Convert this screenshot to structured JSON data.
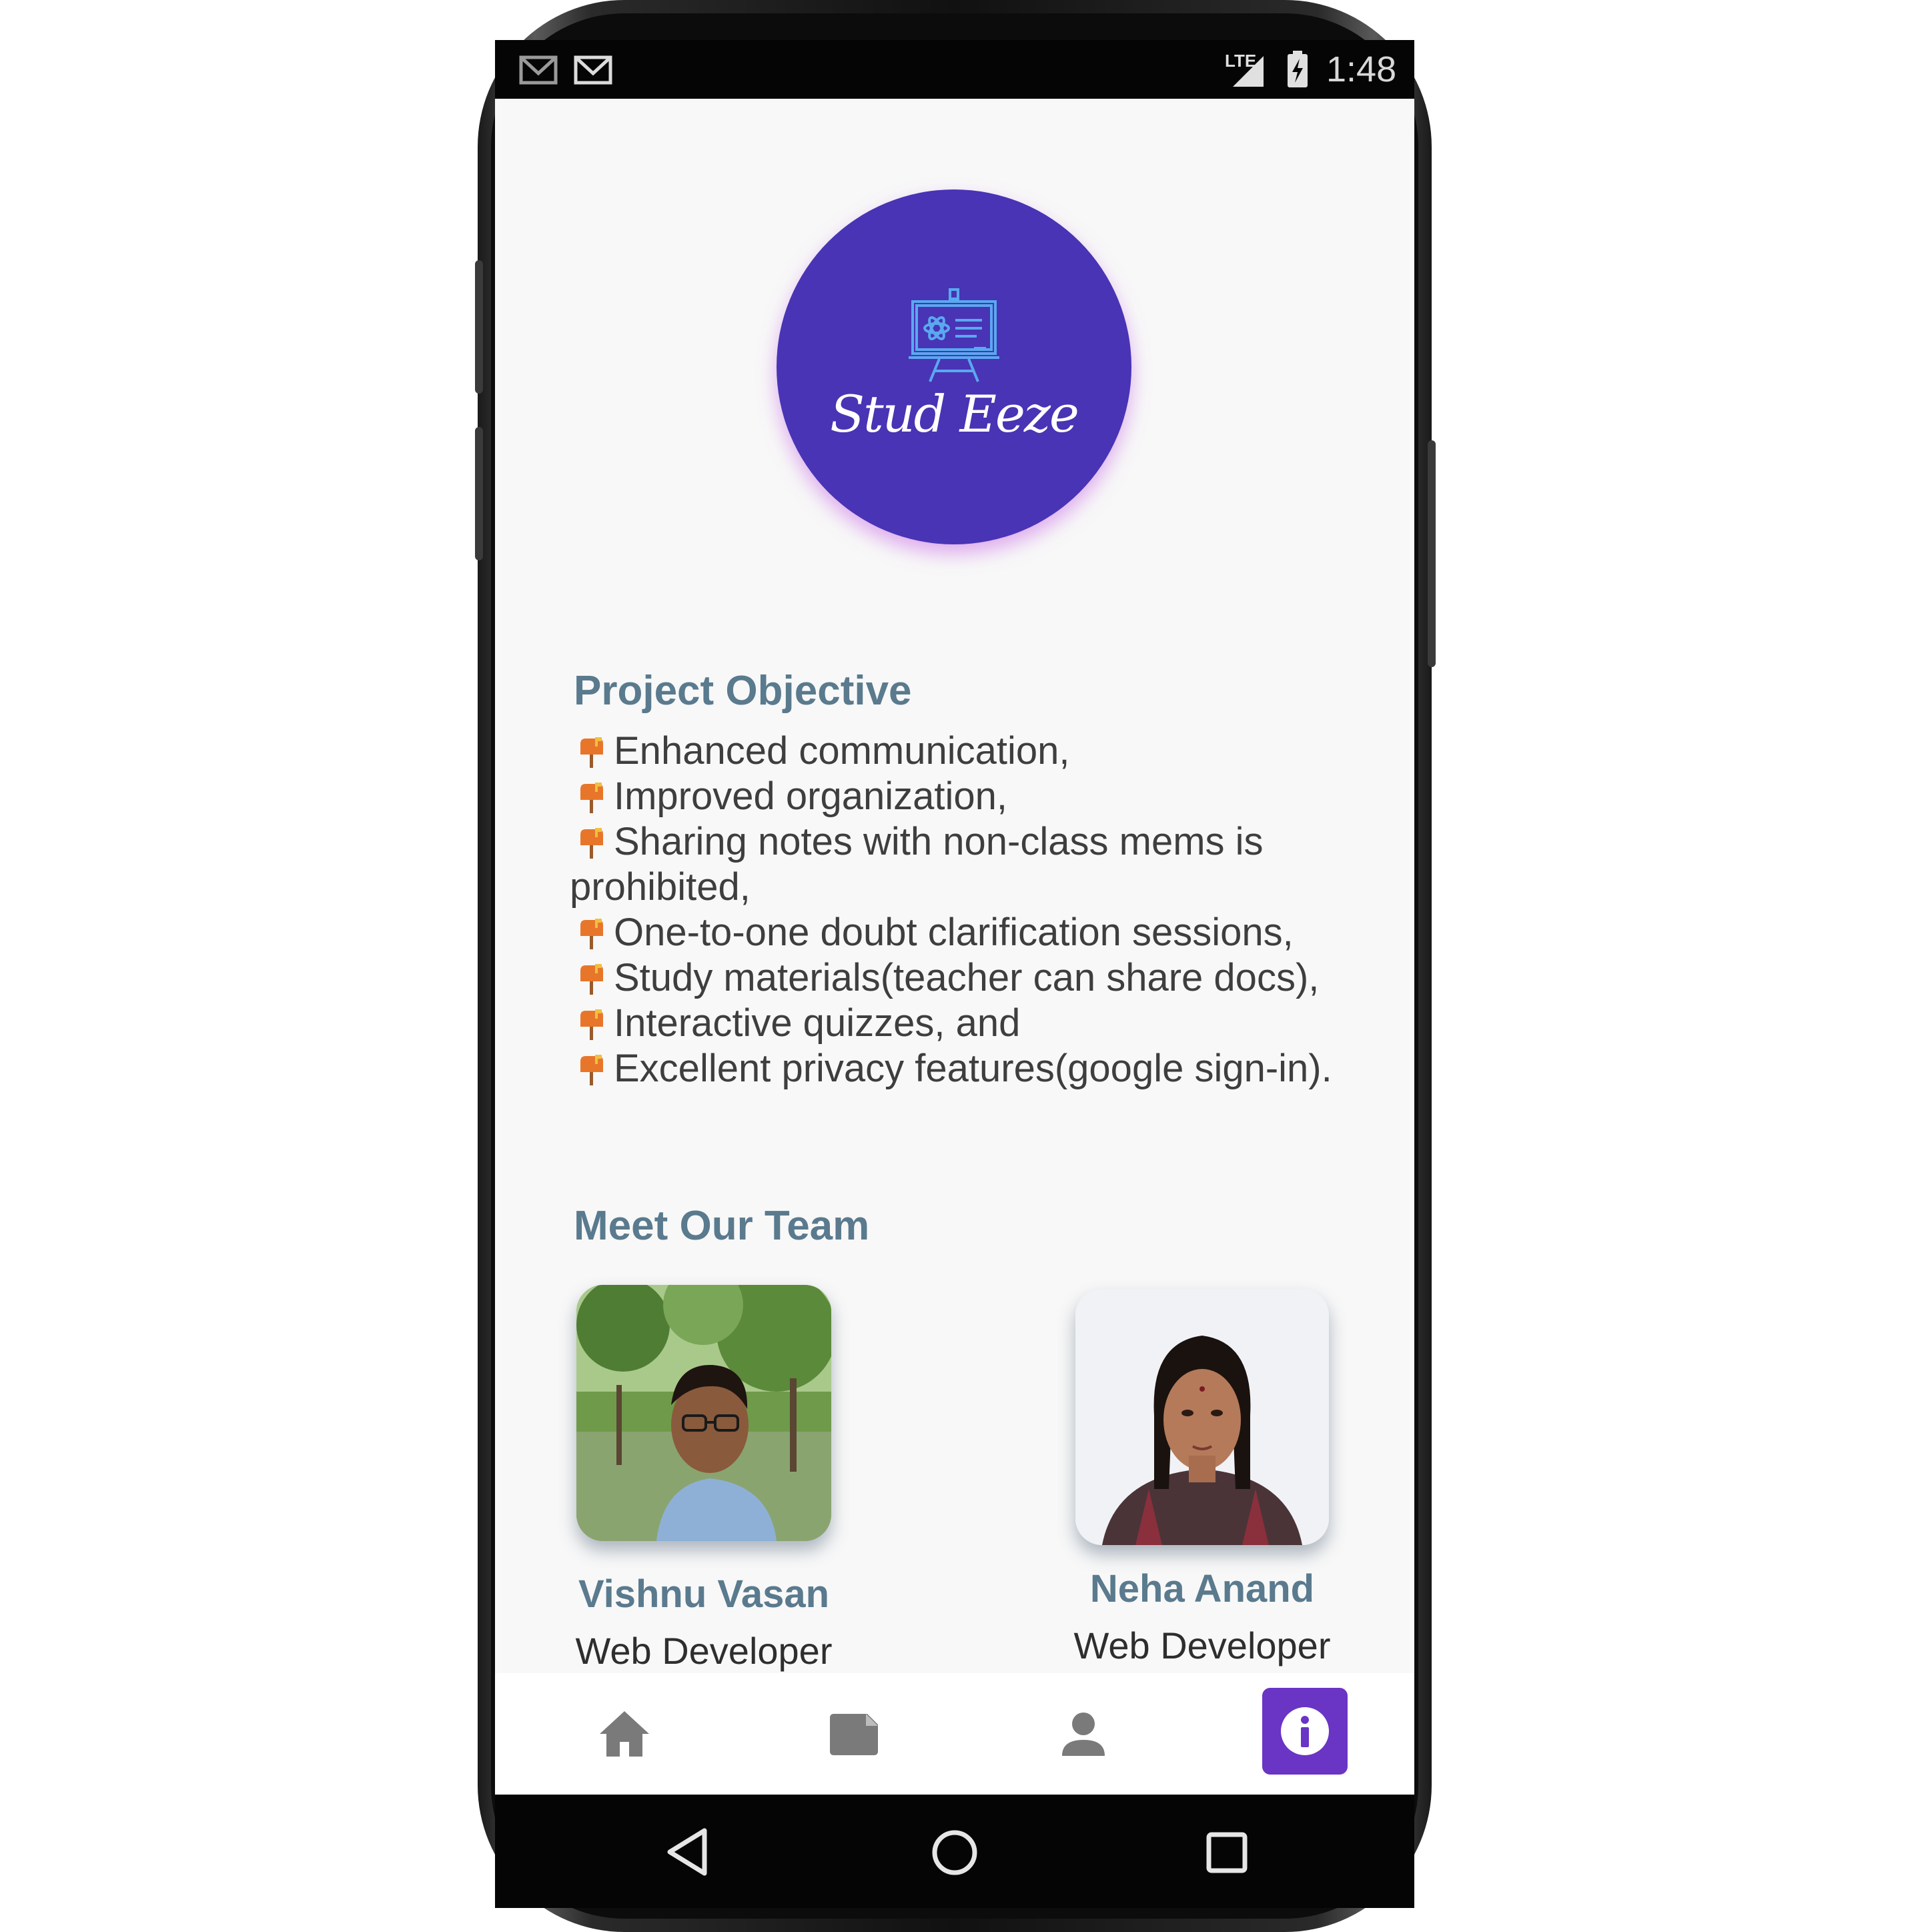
{
  "status_bar": {
    "time": "1:48",
    "network": "LTE"
  },
  "app": {
    "logo_text": "Stud Eeze"
  },
  "objective": {
    "title": "Project Objective",
    "items": [
      "Enhanced communication,",
      "Improved organization,",
      "Sharing notes with non-class mems is prohibited,",
      "One-to-one doubt clarification sessions,",
      "Study materials(teacher can share docs),",
      "Interactive quizzes, and",
      "Excellent privacy features(google sign-in)."
    ]
  },
  "team": {
    "title": "Meet Our Team",
    "members": [
      {
        "name": "Vishnu Vasan",
        "role": "Web Developer"
      },
      {
        "name": "Neha Anand",
        "role": "Web Developer"
      }
    ]
  },
  "bottom_nav": {
    "items": [
      {
        "icon": "home-icon"
      },
      {
        "icon": "document-icon"
      },
      {
        "icon": "person-icon"
      },
      {
        "icon": "info-icon",
        "active": true
      }
    ]
  },
  "colors": {
    "accent": "#4834b4",
    "nav_active": "#6a34c4",
    "heading": "#5a7a8e",
    "text": "#3e3e3e"
  }
}
